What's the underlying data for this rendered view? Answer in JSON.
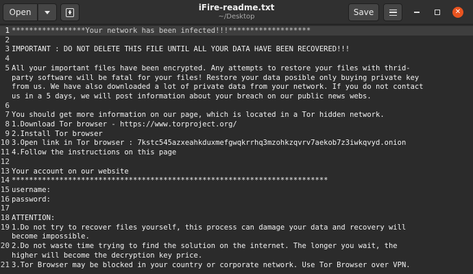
{
  "header": {
    "open_label": "Open",
    "save_label": "Save",
    "title": "iFire-readme.txt",
    "subtitle": "~/Desktop"
  },
  "window_controls": {
    "close_symbol": "✕",
    "close_color": "#e95420"
  },
  "editor": {
    "lines": [
      {
        "n": "1",
        "text": "*****************Your network has been infected!!!*******************"
      },
      {
        "n": "2",
        "text": ""
      },
      {
        "n": "3",
        "text": "IMPORTANT : DO NOT DELETE THIS FILE UNTIL ALL YOUR DATA HAVE BEEN RECOVERED!!!"
      },
      {
        "n": "4",
        "text": ""
      },
      {
        "n": "5",
        "text": "All your important files have been encrypted. Any attempts to restore your files with thrid-"
      },
      {
        "n": "",
        "text": "party software will be fatal for your files! Restore your data posible only buying private key"
      },
      {
        "n": "",
        "text": "from us. We have also downloaded a lot of private data from your network. If you do not contact"
      },
      {
        "n": "",
        "text": "us in a 5 days, we will post information about your breach on our public news webs."
      },
      {
        "n": "6",
        "text": ""
      },
      {
        "n": "7",
        "text": "You should get more information on our page, which is located in a Tor hidden network."
      },
      {
        "n": "8",
        "text": "1.Download Tor browser - https://www.torproject.org/"
      },
      {
        "n": "9",
        "text": "2.Install Tor browser"
      },
      {
        "n": "10",
        "text": "3.Open link in Tor browser : 7kstc545azxeahkduxmefgwqkrrhq3mzohkzqvrv7aekob7z3iwkqvyd.onion"
      },
      {
        "n": "11",
        "text": "4.Follow the instructions on this page"
      },
      {
        "n": "12",
        "text": ""
      },
      {
        "n": "13",
        "text": "Your account on our website"
      },
      {
        "n": "14",
        "text": "*************************************************************************"
      },
      {
        "n": "15",
        "text": "username:"
      },
      {
        "n": "16",
        "text": "password:"
      },
      {
        "n": "17",
        "text": ""
      },
      {
        "n": "18",
        "text": "ATTENTION:"
      },
      {
        "n": "19",
        "text": "1.Do not try to recover files yourself, this process can damage your data and recovery will"
      },
      {
        "n": "",
        "text": "become impossible."
      },
      {
        "n": "20",
        "text": "2.Do not waste time trying to find the solution on the internet. The longer you wait, the"
      },
      {
        "n": "",
        "text": "higher will become the decryption key price."
      },
      {
        "n": "21",
        "text": "3.Tor Browser may be blocked in your country or corporate network. Use Tor Browser over VPN."
      }
    ]
  }
}
